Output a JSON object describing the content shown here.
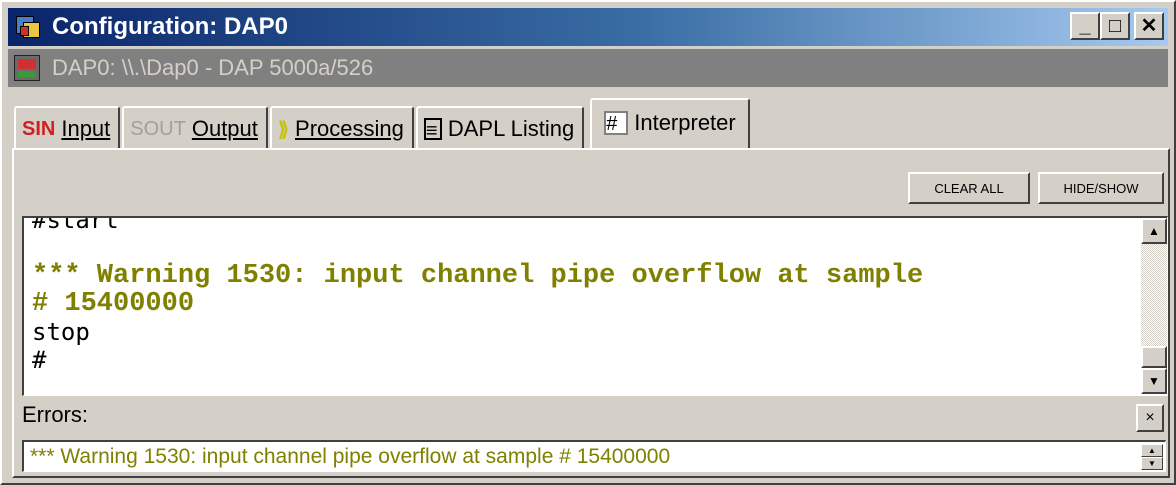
{
  "window": {
    "title": "Configuration: DAP0",
    "minimize_glyph": "_",
    "maximize_glyph": "□",
    "close_glyph": "✕"
  },
  "device": {
    "label": "DAP0: \\\\.\\Dap0 - DAP 5000a/526"
  },
  "tabs": [
    {
      "icon": "input-icon",
      "icon_text": "SIN",
      "label": "Input",
      "active": false
    },
    {
      "icon": "output-icon",
      "icon_text": "SOUT",
      "label": "Output",
      "active": false
    },
    {
      "icon": "processing-icon",
      "icon_text": "⟫",
      "label": "Processing",
      "active": false
    },
    {
      "icon": "listing-icon",
      "icon_text": "≡",
      "label": "DAPL Listing",
      "active": false
    },
    {
      "icon": "interpreter-icon",
      "icon_text": "#",
      "label": "Interpreter",
      "active": true
    }
  ],
  "toolbar": {
    "clear_all_label": "CLEAR ALL",
    "hide_show_label": "HIDE/SHOW"
  },
  "output": {
    "line_partial": "#start",
    "warning_line_1": "*** Warning 1530: input channel pipe overflow at sample",
    "warning_line_2": "# 15400000",
    "line_stop": "stop",
    "line_prompt": "#"
  },
  "scrollbar": {
    "up_glyph": "▲",
    "down_glyph": "▼"
  },
  "errors": {
    "label": "Errors:",
    "close_glyph": "×",
    "value": "*** Warning 1530: input channel pipe overflow at sample # 15400000",
    "spin_up": "▲",
    "spin_down": "▼"
  },
  "colors": {
    "title_gradient_start": "#0a246a",
    "title_gradient_end": "#a6caf0",
    "face": "#d4d0c8",
    "warning_text": "#808000"
  }
}
